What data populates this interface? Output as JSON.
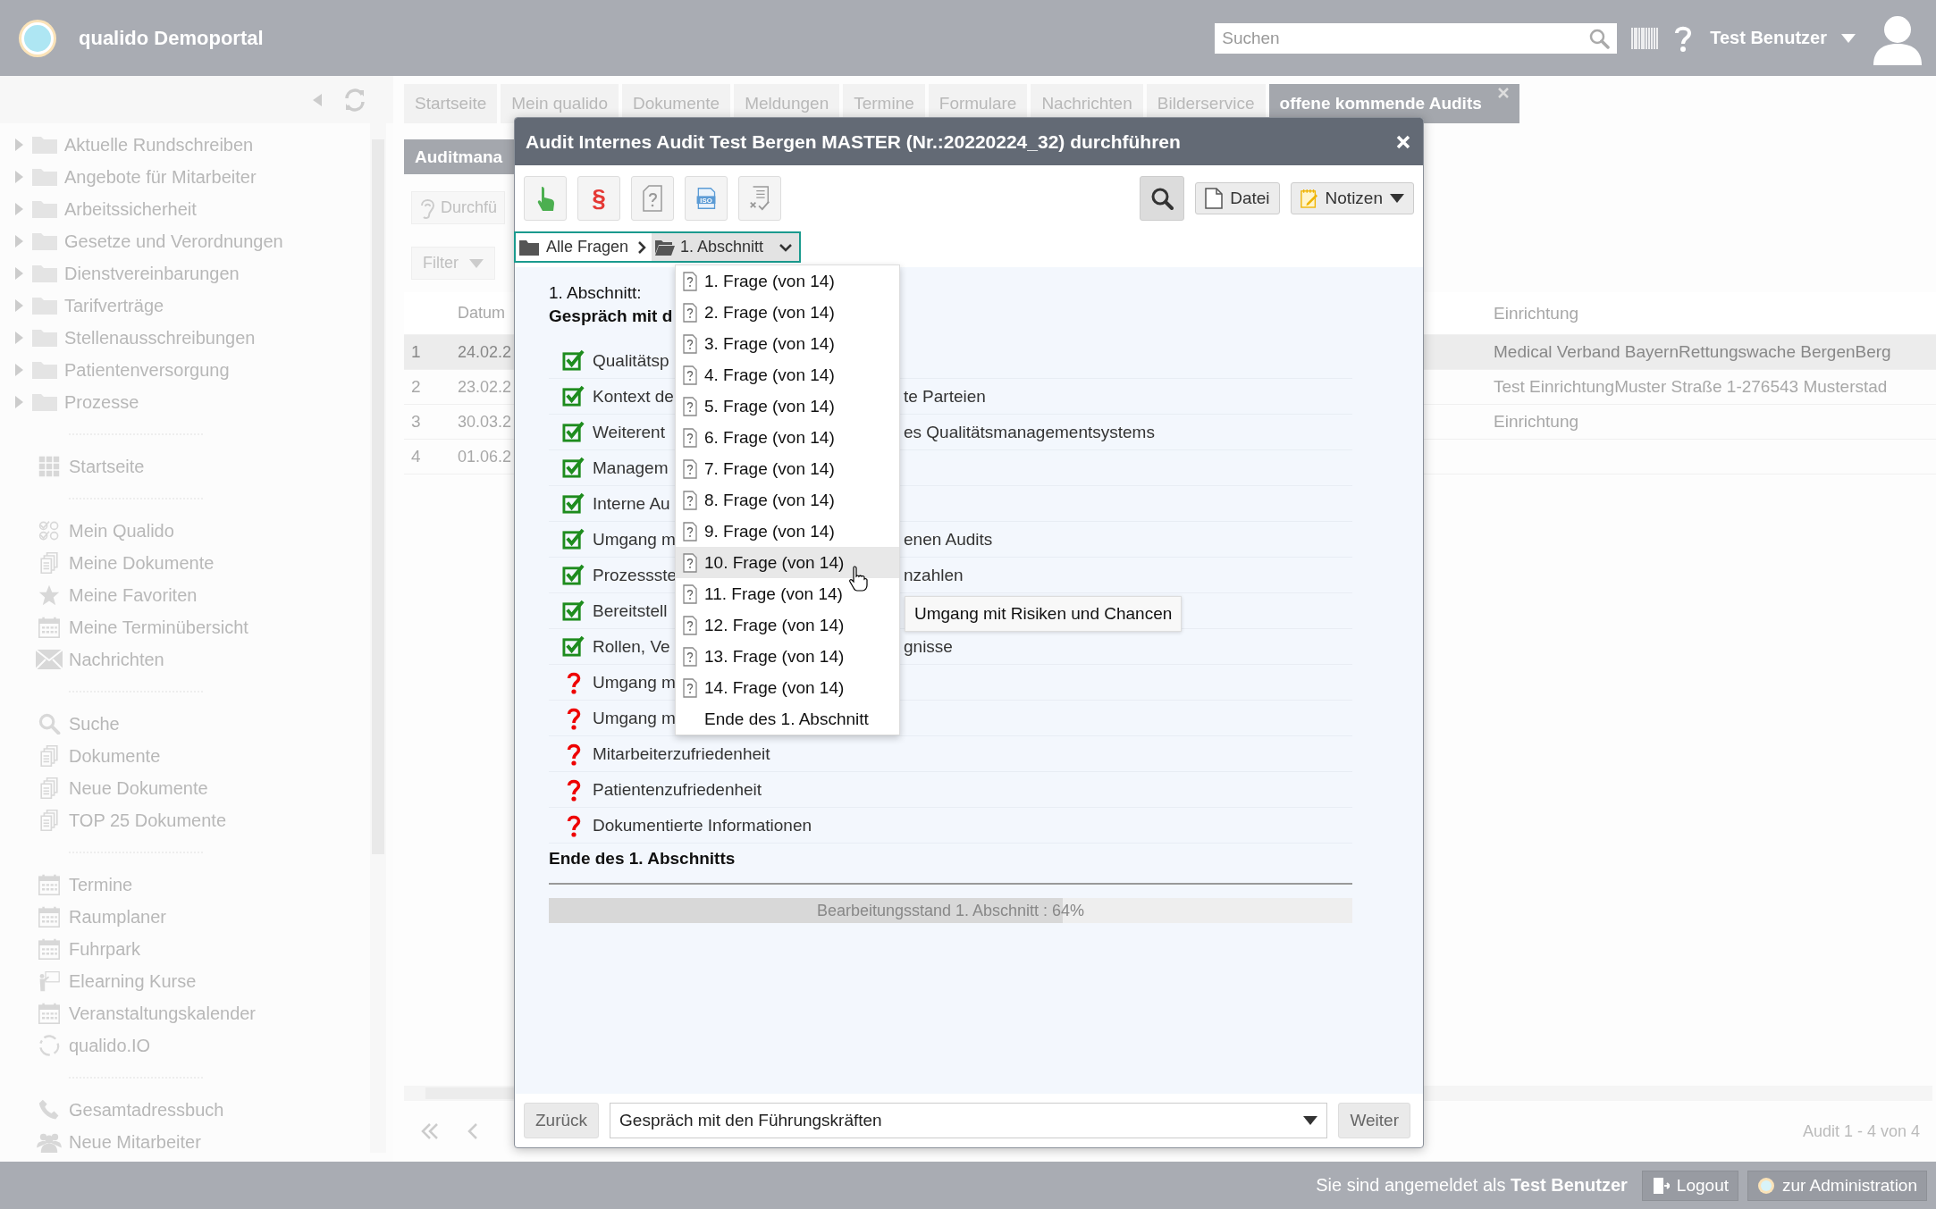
{
  "header": {
    "title": "qualido Demoportal",
    "search": {
      "placeholder": "Suchen"
    },
    "user": "Test Benutzer"
  },
  "sidebar": {
    "tree": [
      {
        "label": "Aktuelle Rundschreiben",
        "expanded": false
      },
      {
        "label": "Angebote für Mitarbeiter",
        "expanded": false
      },
      {
        "label": "Arbeitssicherheit",
        "expanded": false
      },
      {
        "label": "Gesetze und Verordnungen",
        "expanded": false
      },
      {
        "label": "Dienstvereinbarungen",
        "expanded": false
      },
      {
        "label": "Tarifverträge",
        "expanded": false
      },
      {
        "label": "Stellenausschreibungen",
        "expanded": false
      },
      {
        "label": "Patientenversorgung",
        "expanded": false
      },
      {
        "label": "Prozesse",
        "expanded": false
      }
    ],
    "groups": [
      [
        {
          "label": "Startseite",
          "kind": "grid"
        }
      ],
      [
        {
          "label": "Mein Qualido",
          "kind": "checks"
        },
        {
          "label": "Meine Dokumente",
          "kind": "docs"
        },
        {
          "label": "Meine Favoriten",
          "kind": "star"
        },
        {
          "label": "Meine Terminübersicht",
          "kind": "calendar"
        },
        {
          "label": "Nachrichten",
          "kind": "mail"
        }
      ],
      [
        {
          "label": "Suche",
          "kind": "search"
        },
        {
          "label": "Dokumente",
          "kind": "docs"
        },
        {
          "label": "Neue Dokumente",
          "kind": "docs"
        },
        {
          "label": "TOP 25 Dokumente",
          "kind": "docs"
        }
      ],
      [
        {
          "label": "Termine",
          "kind": "calendar"
        },
        {
          "label": "Raumplaner",
          "kind": "calendar"
        },
        {
          "label": "Fuhrpark",
          "kind": "calendar"
        },
        {
          "label": "Elearning Kurse",
          "kind": "teacher"
        },
        {
          "label": "Veranstaltungskalender",
          "kind": "calendar"
        },
        {
          "label": "qualido.IO",
          "kind": "cycle"
        }
      ],
      [
        {
          "label": "Gesamtadressbuch",
          "kind": "phone"
        },
        {
          "label": "Neue Mitarbeiter",
          "kind": "people"
        }
      ]
    ]
  },
  "tabs": [
    {
      "label": "Startseite",
      "selected": false
    },
    {
      "label": "Mein qualido",
      "selected": false
    },
    {
      "label": "Dokumente",
      "selected": false
    },
    {
      "label": "Meldungen",
      "selected": false
    },
    {
      "label": "Termine",
      "selected": false
    },
    {
      "label": "Formulare",
      "selected": false
    },
    {
      "label": "Nachrichten",
      "selected": false
    },
    {
      "label": "Bilderservice",
      "selected": false
    },
    {
      "label": "offene kommende Audits",
      "selected": true
    }
  ],
  "subtab": "Auditmana",
  "actions": {
    "run": "Durchfü",
    "filter": "Filter"
  },
  "table": {
    "columns": [
      "Datum",
      "Einrichtung"
    ],
    "rows": [
      {
        "num": "1",
        "date": "24.02.2",
        "facility": "Medical Verband BayernRettungswache BergenBerg",
        "selected": true
      },
      {
        "num": "2",
        "date": "23.02.2",
        "facility": "Test EinrichtungMuster Straße 1-276543 Musterstad",
        "selected": false
      },
      {
        "num": "3",
        "date": "30.03.2",
        "facility": "Einrichtung",
        "selected": false
      },
      {
        "num": "4",
        "date": "01.06.2",
        "selected": false
      }
    ]
  },
  "pager": {
    "summary": "Audit 1 - 4 von 4"
  },
  "dialog": {
    "title": "Audit Internes Audit Test Bergen MASTER (Nr.:20220224_32) durchführen",
    "tools": [
      {
        "kind": "pointer"
      },
      {
        "kind": "glyph",
        "glyph": "§"
      },
      {
        "kind": "doc-question"
      },
      {
        "kind": "iso",
        "label": "ISO"
      },
      {
        "kind": "checklist"
      }
    ],
    "file_button": "Datei",
    "notes_button": "Notizen",
    "breadcrumb": {
      "root": "Alle Fragen",
      "current": "1. Abschnitt"
    },
    "section_label": "1. Abschnitt:",
    "section_title": "Gespräch mit d",
    "rows": [
      {
        "kind": "done",
        "left": "Qualitätsp"
      },
      {
        "kind": "done",
        "left": "Kontext de",
        "right": "te Parteien"
      },
      {
        "kind": "done",
        "left": "Weiterent",
        "right": "es Qualitätsmanagementsystems"
      },
      {
        "kind": "done",
        "left": "Managem"
      },
      {
        "kind": "done",
        "left": "Interne Au"
      },
      {
        "kind": "done",
        "left": "Umgang m",
        "right": "enen Audits"
      },
      {
        "kind": "done",
        "left": "Prozessste",
        "right": "nzahlen"
      },
      {
        "kind": "done",
        "left": "Bereitstell"
      },
      {
        "kind": "done",
        "left": "Rollen, Ve",
        "right": "gnisse"
      },
      {
        "kind": "open",
        "left": "Umgang m"
      },
      {
        "kind": "open",
        "left": "Umgang m"
      },
      {
        "kind": "open",
        "left": "Mitarbeiterzufriedenheit"
      },
      {
        "kind": "open",
        "left": "Patientenzufriedenheit"
      },
      {
        "kind": "open",
        "left": "Dokumentierte Informationen"
      }
    ],
    "end_label": "Ende des 1. Abschnitts",
    "progress": {
      "label": "Bearbeitungsstand 1. Abschnitt : 64%",
      "level": 0.64
    },
    "menu": [
      {
        "label": "1. Frage (von 14)",
        "kind": "question",
        "hovered": false
      },
      {
        "label": "2. Frage (von 14)",
        "kind": "question",
        "hovered": false
      },
      {
        "label": "3. Frage (von 14)",
        "kind": "question",
        "hovered": false
      },
      {
        "label": "4. Frage (von 14)",
        "kind": "question",
        "hovered": false
      },
      {
        "label": "5. Frage (von 14)",
        "kind": "question",
        "hovered": false
      },
      {
        "label": "6. Frage (von 14)",
        "kind": "question",
        "hovered": false
      },
      {
        "label": "7. Frage (von 14)",
        "kind": "question",
        "hovered": false
      },
      {
        "label": "8. Frage (von 14)",
        "kind": "question",
        "hovered": false
      },
      {
        "label": "9. Frage (von 14)",
        "kind": "question",
        "hovered": false
      },
      {
        "label": "10. Frage (von 14)",
        "kind": "question",
        "hovered": true
      },
      {
        "label": "11. Frage (von 14)",
        "kind": "question",
        "hovered": false
      },
      {
        "label": "12. Frage (von 14)",
        "kind": "question",
        "hovered": false
      },
      {
        "label": "13. Frage (von 14)",
        "kind": "question",
        "hovered": false
      },
      {
        "label": "14. Frage (von 14)",
        "kind": "question",
        "hovered": false
      },
      {
        "label": "Ende des 1. Abschnitt",
        "kind": "end",
        "hovered": false
      }
    ],
    "tooltip": "Umgang mit Risiken und Chancen",
    "footer": {
      "back": "Zurück",
      "select": "Gespräch mit den Führungskräften",
      "next": "Weiter"
    }
  },
  "status_bar": {
    "text": "Sie sind angemeldet als **Test Benutzer**",
    "buttons": [
      "Logout",
      "zur Administration"
    ]
  }
}
